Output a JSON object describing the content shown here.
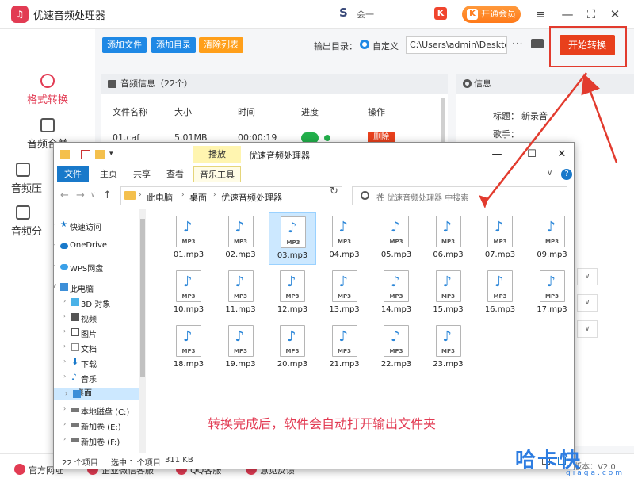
{
  "app": {
    "title": "优速音频处理器",
    "logo_icon": "headphones-icon",
    "promo_text": "会一",
    "k_badge": "K",
    "vip_label": "开通会员",
    "menu_icon": "menu-icon",
    "minimize_icon": "minimize-icon",
    "maximize_icon": "maximize-icon",
    "close_icon": "close-icon"
  },
  "sidebar": {
    "items": [
      {
        "label": "格式转换",
        "active": true
      },
      {
        "label": "音频合并"
      },
      {
        "label": "音频压"
      },
      {
        "label": "音频分"
      }
    ]
  },
  "toolbar": {
    "add_file": "添加文件",
    "add_dir": "添加目录",
    "clear_list": "清除列表",
    "output_label": "输出目录：",
    "custom_label": "自定义",
    "output_path": "C:\\Users\\admin\\Deskto",
    "more": "···",
    "start": "开始转换"
  },
  "list_panel": {
    "title": "音频信息（22个）",
    "columns": [
      "文件名称",
      "大小",
      "时间",
      "进度",
      "操作"
    ],
    "rows": [
      {
        "name": "01.caf",
        "size": "5.01MB",
        "time": "00:00:19",
        "action": "删除"
      }
    ]
  },
  "info_panel": {
    "title": "信息",
    "title_label": "标题：",
    "title_value": "新录音",
    "singer_label": "歌手：",
    "dropdowns": [
      "∨",
      "∨",
      "∨"
    ],
    "version": "版本：V2.0"
  },
  "footer": {
    "items": [
      "官方网址",
      "企业微信客服",
      "QQ客服",
      "意见反馈"
    ]
  },
  "watermark": {
    "main": "哈卡快",
    "sub": "qiaqa.com"
  },
  "explorer": {
    "title": "优速音频处理器",
    "context_tab_top": "播放",
    "ribbon_tabs": [
      "文件",
      "主页",
      "共享",
      "查看",
      "音乐工具"
    ],
    "breadcrumbs": [
      "此电脑",
      "桌面",
      "优速音频处理器"
    ],
    "search_placeholder": "在 优速音频处理器 中搜索",
    "nav_items": [
      {
        "label": "快速访问",
        "icon": "star-icon"
      },
      {
        "label": "OneDrive",
        "icon": "cloud-icon"
      },
      {
        "label": "WPS网盘",
        "icon": "cloud-icon"
      },
      {
        "label": "此电脑",
        "icon": "computer-icon"
      },
      {
        "label": "3D 对象",
        "icon": "cube-icon"
      },
      {
        "label": "视频",
        "icon": "video-icon"
      },
      {
        "label": "图片",
        "icon": "picture-icon"
      },
      {
        "label": "文档",
        "icon": "document-icon"
      },
      {
        "label": "下载",
        "icon": "download-icon"
      },
      {
        "label": "音乐",
        "icon": "music-icon"
      },
      {
        "label": "桌面",
        "icon": "desktop-icon"
      },
      {
        "label": "本地磁盘 (C:)",
        "icon": "drive-icon"
      },
      {
        "label": "新加卷 (E:)",
        "icon": "drive-icon"
      },
      {
        "label": "新加卷 (F:)",
        "icon": "drive-icon"
      }
    ],
    "files": [
      "01.mp3",
      "02.mp3",
      "03.mp3",
      "04.mp3",
      "05.mp3",
      "06.mp3",
      "07.mp3",
      "09.mp3",
      "10.mp3",
      "11.mp3",
      "12.mp3",
      "13.mp3",
      "14.mp3",
      "15.mp3",
      "16.mp3",
      "17.mp3",
      "18.mp3",
      "19.mp3",
      "20.mp3",
      "21.mp3",
      "22.mp3",
      "23.mp3"
    ],
    "file_tag": "MP3",
    "selected_file": "03.mp3",
    "status": {
      "count": "22 个项目",
      "selected": "选中 1 个项目",
      "size": "311 KB"
    }
  },
  "annotation": "转换完成后，软件会自动打开输出文件夹",
  "colors": {
    "accent_red": "#e23b53",
    "start_button": "#e8401c",
    "blue_button": "#1e88e5",
    "orange_button": "#ff9f1a",
    "explorer_blue": "#1979ca",
    "selection": "#cce8ff"
  }
}
